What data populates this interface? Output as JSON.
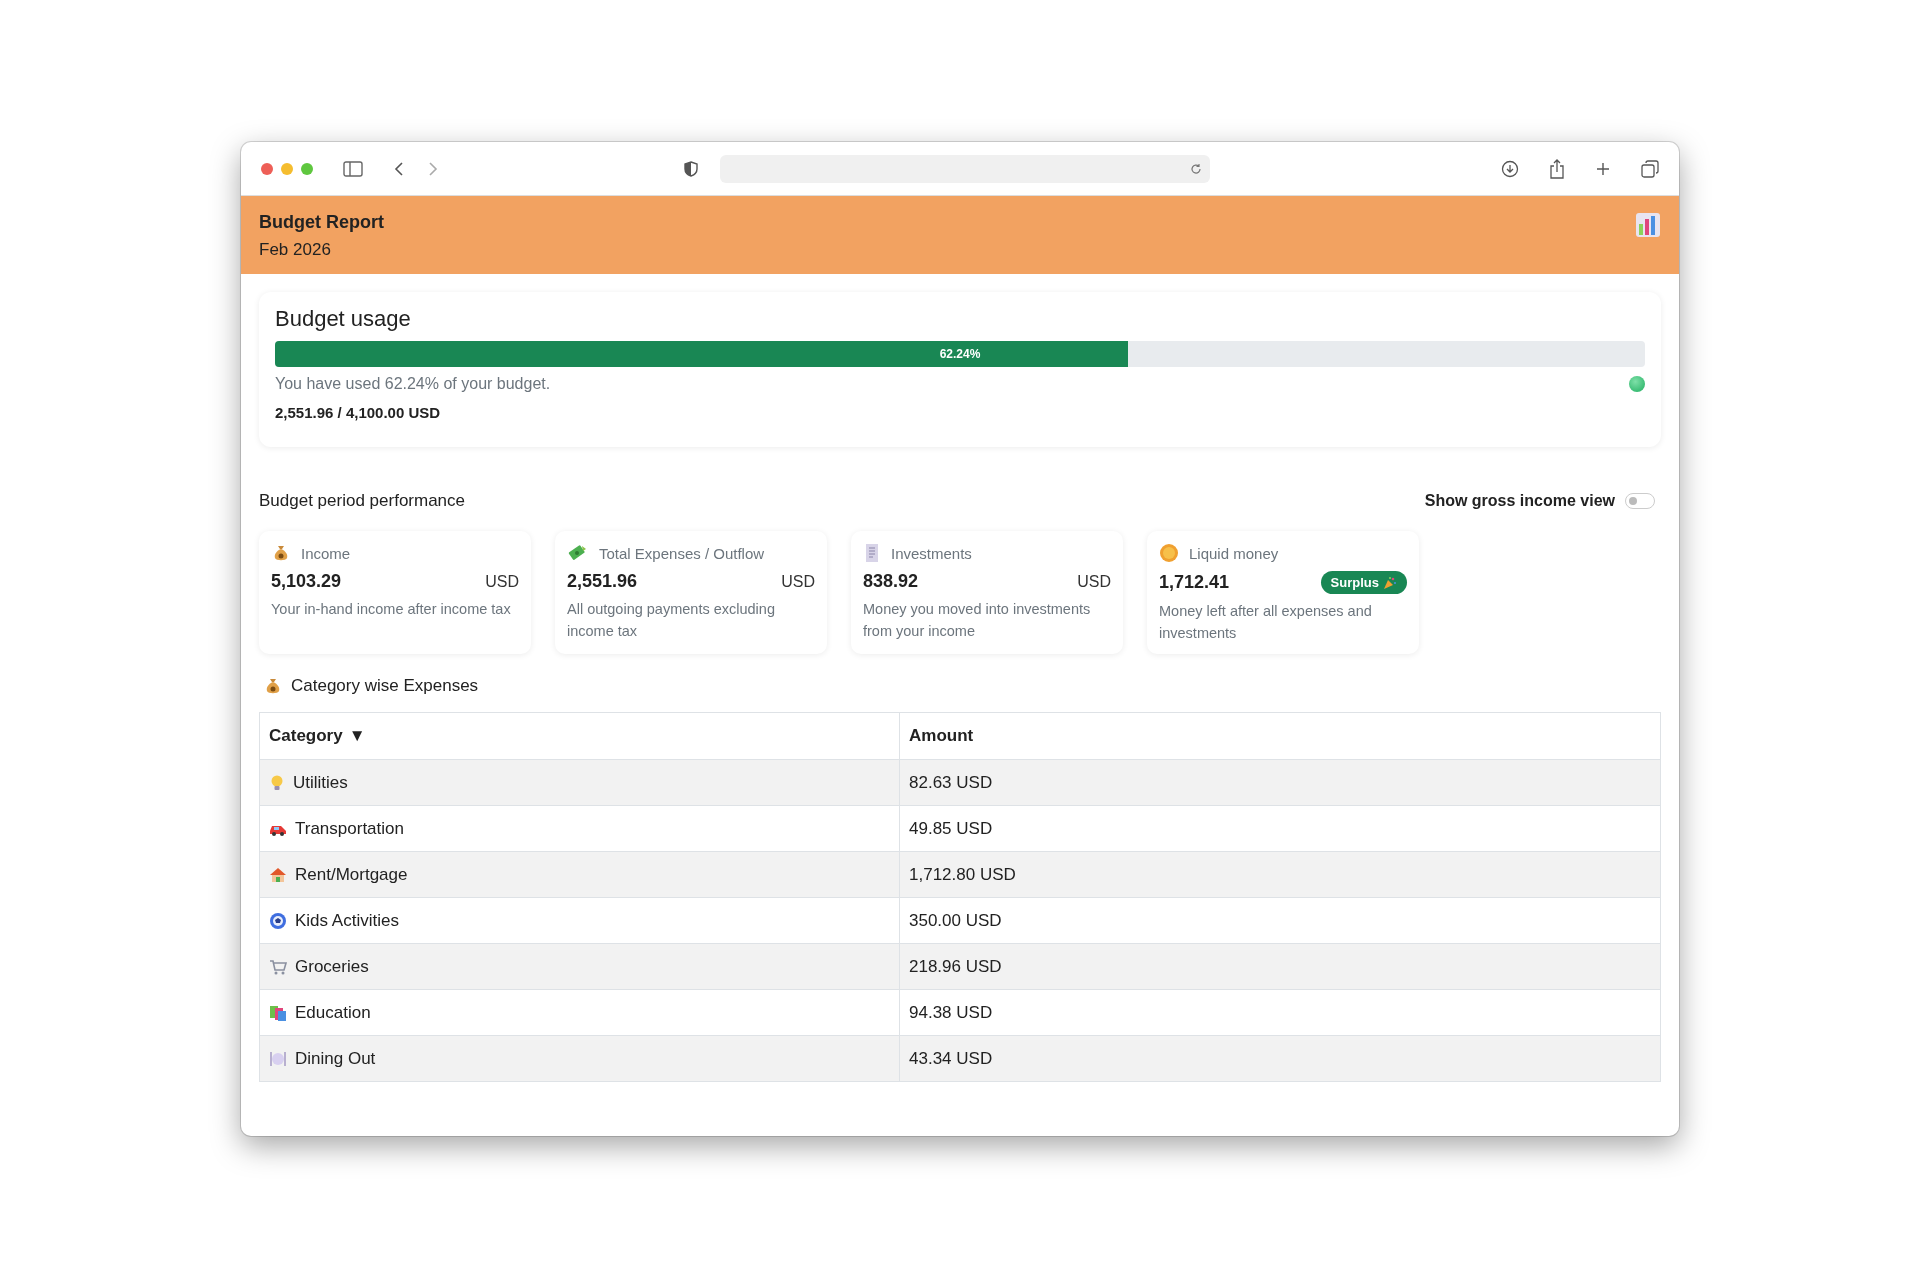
{
  "header": {
    "title": "Budget Report",
    "subtitle": "Feb 2026"
  },
  "budget_usage": {
    "title": "Budget usage",
    "level": 0.6224,
    "bar_label": "62.24%",
    "message": "You have used 62.24% of your budget.",
    "totals": "2,551.96 / 4,100.00 USD"
  },
  "performance": {
    "title": "Budget period performance",
    "toggle": {
      "label": "Show gross income view",
      "on": false
    },
    "cards": [
      {
        "label": "Income",
        "value": "5,103.29",
        "unit": "USD",
        "description": "Your in-hand income after income tax"
      },
      {
        "label": "Total Expenses / Outflow",
        "value": "2,551.96",
        "unit": "USD",
        "description": "All outgoing payments excluding income tax"
      },
      {
        "label": "Investments",
        "value": "838.92",
        "unit": "USD",
        "description": "Money you moved into investments from your income"
      },
      {
        "label": "Liquid money",
        "value": "1,712.41",
        "badge": "Surplus",
        "description": "Money left after all expenses and investments"
      }
    ]
  },
  "expenses": {
    "title": "Category wise Expenses",
    "columns": [
      {
        "label": "Category",
        "sort": "▼"
      },
      {
        "label": "Amount"
      }
    ],
    "rows": [
      {
        "category": "Utilities",
        "amount": "82.63 USD"
      },
      {
        "category": "Transportation",
        "amount": "49.85 USD"
      },
      {
        "category": "Rent/Mortgage",
        "amount": "1,712.80 USD"
      },
      {
        "category": "Kids Activities",
        "amount": "350.00 USD"
      },
      {
        "category": "Groceries",
        "amount": "218.96 USD"
      },
      {
        "category": "Education",
        "amount": "94.38 USD"
      },
      {
        "category": "Dining Out",
        "amount": "43.34 USD"
      }
    ]
  }
}
